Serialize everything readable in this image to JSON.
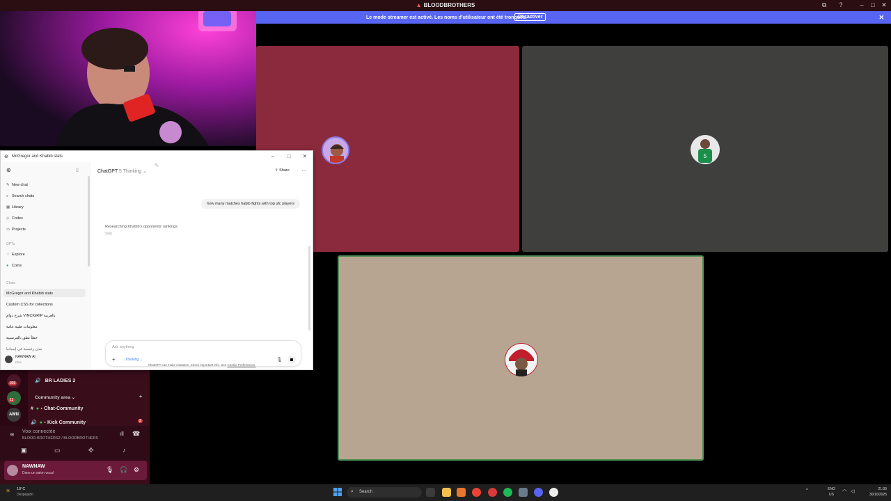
{
  "window": {
    "title": "BLOODBROTHERS"
  },
  "streamer_banner": {
    "message": "Le mode streamer est activé. Les noms d'utilisateur ont été tronqués.",
    "button": "Désactiver"
  },
  "chatgpt": {
    "window_title": "McGregor and Khabib stats",
    "model_label": "ChatGPT",
    "model_variant": "5 Thinking",
    "share_label": "Share",
    "sidebar": {
      "items": [
        {
          "icon": "edit-icon",
          "label": "New chat"
        },
        {
          "icon": "search-icon",
          "label": "Search chats"
        },
        {
          "icon": "library-icon",
          "label": "Library"
        },
        {
          "icon": "codex-icon",
          "label": "Codex"
        },
        {
          "icon": "folder-icon",
          "label": "Projects"
        }
      ],
      "gpts_label": "GPTs",
      "gpts": [
        {
          "icon": "explore-icon",
          "label": "Explore"
        },
        {
          "icon": "coins-icon",
          "label": "Coins"
        }
      ],
      "chats_label": "Chats",
      "chats": [
        "McGregor and Khabib stats",
        "Custom CSS for collections",
        "شرح دوام VINCIGRIP بالعربية",
        "معلومات طبية عامة",
        "خطأ نطق بالفرنسية",
        "مدن رئيسية في إسبانيا"
      ],
      "user_name": "NAWNAW AI",
      "user_plan": "Plus"
    },
    "user_message": "how many matches habib fights with top ufc players",
    "status_text": "Researching Khabib's opponents' rankings",
    "skip_label": "Skip",
    "composer_placeholder": "Ask anything",
    "thinking_chip": "Thinking",
    "disclaimer": "ChatGPT can make mistakes. Check important info. See",
    "cookie_link": "Cookie Preferences."
  },
  "discord": {
    "server_badges": [
      "939",
      "11"
    ],
    "server_label": "AWN",
    "channels": [
      {
        "label": "BR LADIES 2",
        "type": "voice"
      },
      {
        "label": "Community area",
        "type": "category"
      },
      {
        "label": "・Chat-Community",
        "type": "text"
      },
      {
        "label": "・Kick Community",
        "type": "voice",
        "badge": "2"
      }
    ],
    "voice_status": "Voix connectée",
    "voice_channel": "BLOOD-BROTHERS2 / BLOODBROTHERS",
    "username": "NAWNAW",
    "user_status": "Dans un salon vocal"
  },
  "taskbar": {
    "weather_temp": "18°C",
    "weather_desc": "Despejado",
    "search_placeholder": "Search",
    "lang_top": "ENG",
    "lang_bottom": "US",
    "time": "21:35",
    "date": "30/10/2025"
  },
  "colors": {
    "discord_bar": "#2a0e12",
    "streamer_banner": "#5865f2",
    "tile_red": "#8b2a3c",
    "tile_gray": "#3f3f3d",
    "tile_beige": "#b7a592",
    "speaking_border": "#4e8d52"
  }
}
